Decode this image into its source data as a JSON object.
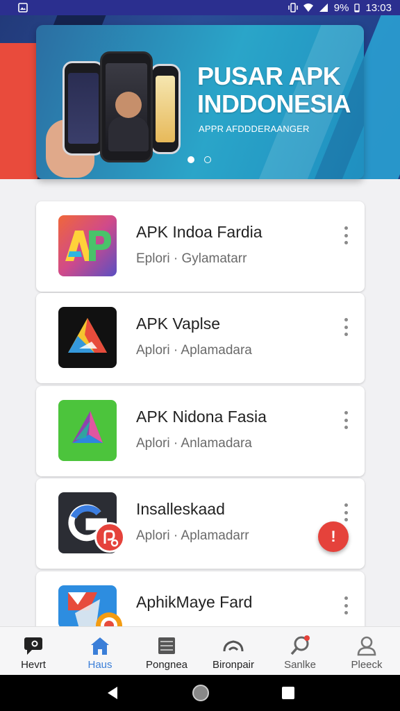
{
  "status_bar": {
    "battery": "9%",
    "time": "13:03"
  },
  "banner": {
    "title_line1": "PUSAR APK",
    "title_line2": "INDDONESIA",
    "subtitle": "APPR AFDDDERAANGER",
    "page_index": 0,
    "page_count": 2
  },
  "apps": [
    {
      "name": "APK Indoa Fardia",
      "meta": "Eplori · Gylamatarr",
      "icon": "ap-logo-icon"
    },
    {
      "name": "APK Vaplse",
      "meta": "Aplori · Aplamadara",
      "icon": "triangle-logo-icon"
    },
    {
      "name": "APK Nidona Fasia",
      "meta": "Aplori · Anlamadara",
      "icon": "prism-logo-icon"
    },
    {
      "name": "Insalleskaad",
      "meta": "Aplori · Aplamadarr",
      "icon": "g-logo-icon"
    },
    {
      "name": "AphikMaye Fard",
      "meta": "",
      "icon": "flag-logo-icon"
    }
  ],
  "fab": {
    "label": "!"
  },
  "bottom_nav": [
    {
      "label": "Hevrt",
      "icon": "chat-icon"
    },
    {
      "label": "Haus",
      "icon": "home-icon"
    },
    {
      "label": "Pongnea",
      "icon": "stack-icon"
    },
    {
      "label": "Bironpair",
      "icon": "cloud-icon"
    },
    {
      "label": "Sanlke",
      "icon": "search-icon"
    },
    {
      "label": "Pleeck",
      "icon": "profile-icon"
    }
  ],
  "colors": {
    "accent": "#3a7ed8",
    "status_bar": "#2b2f8f",
    "fab": "#e5423b"
  }
}
